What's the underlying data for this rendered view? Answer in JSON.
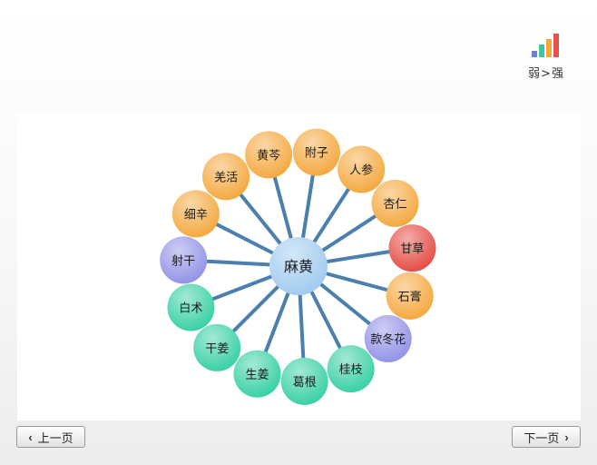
{
  "legend": {
    "label": "弱>强",
    "bar_colors": [
      "#6f7fd9",
      "#3cc6a3",
      "#f2a93b",
      "#e8504a"
    ]
  },
  "center": {
    "label": "麻黄",
    "color": "#9ec9ef"
  },
  "nodes": [
    {
      "label": "黄芩",
      "level": "orange"
    },
    {
      "label": "附子",
      "level": "orange"
    },
    {
      "label": "人参",
      "level": "orange"
    },
    {
      "label": "杏仁",
      "level": "orange"
    },
    {
      "label": "甘草",
      "level": "red"
    },
    {
      "label": "石膏",
      "level": "orange"
    },
    {
      "label": "款冬花",
      "level": "purple"
    },
    {
      "label": "桂枝",
      "level": "green"
    },
    {
      "label": "葛根",
      "level": "green"
    },
    {
      "label": "生姜",
      "level": "green"
    },
    {
      "label": "干姜",
      "level": "green"
    },
    {
      "label": "白术",
      "level": "green"
    },
    {
      "label": "射干",
      "level": "purple"
    },
    {
      "label": "细辛",
      "level": "orange"
    },
    {
      "label": "羌活",
      "level": "orange"
    }
  ],
  "level_colors": {
    "orange": "#f4a63a",
    "red": "#e5473f",
    "purple": "#8f8fe6",
    "green": "#33cfa2"
  },
  "edge_color": "#4a7fae",
  "nav": {
    "prev_label": "上一页",
    "next_label": "下一页"
  }
}
